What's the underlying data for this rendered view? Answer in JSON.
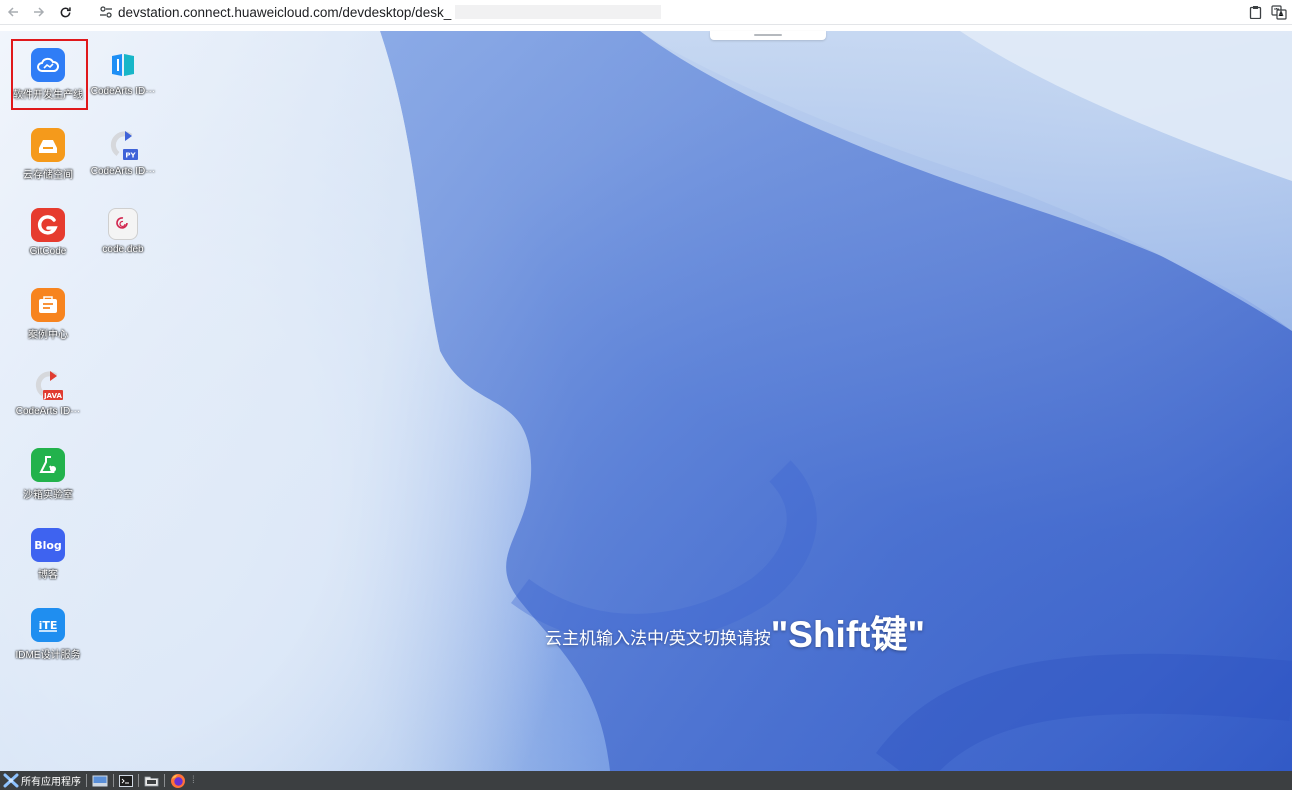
{
  "browser": {
    "back_icon": "arrow-left-icon",
    "forward_icon": "arrow-right-icon",
    "reload_icon": "reload-icon",
    "site_info_icon": "site-settings-icon",
    "url": "devstation.connect.huaweicloud.com/devdesktop/desk_",
    "tools": [
      "clipboard-icon",
      "translate-icon"
    ]
  },
  "desktop": {
    "icons_col1": [
      {
        "label": "软件开发生产线",
        "icon": "cloud-pipeline-icon",
        "color": "#2f7df6",
        "selected": true
      },
      {
        "label": "云存储空间",
        "icon": "cloud-storage-icon",
        "color": "#f59a1b"
      },
      {
        "label": "GitCode",
        "icon": "gitcode-icon",
        "color": "#e63b2e"
      },
      {
        "label": "案例中心",
        "icon": "case-center-icon",
        "color": "#f7841f"
      },
      {
        "label": "CodeArts ID···",
        "icon": "codearts-java-icon",
        "color": "#e03c31"
      },
      {
        "label": "沙箱实验室",
        "icon": "sandbox-lab-icon",
        "color": "#22b24c"
      },
      {
        "label": "博客",
        "icon": "blog-icon",
        "color": "#3e63f0"
      },
      {
        "label": "IDME设计服务",
        "icon": "idme-icon",
        "color": "#1f8ef0"
      }
    ],
    "icons_col2": [
      {
        "label": "CodeArts ID···",
        "icon": "codearts-ide-icon",
        "color": "#1e8ff5"
      },
      {
        "label": "CodeArts ID···",
        "icon": "codearts-python-icon",
        "color": "#3f63d8"
      },
      {
        "label": "code.deb",
        "icon": "debian-package-icon",
        "color": "#f4f4f4"
      }
    ],
    "ime_hint_prefix": "云主机输入法中/英文切换请按",
    "ime_hint_key": "\"Shift键\""
  },
  "taskbar": {
    "apps_label": "所有应用程序",
    "apps_icon": "xfce-mouse-icon",
    "items": [
      "desktop-icon",
      "terminal-icon",
      "file-manager-icon",
      "firefox-icon"
    ]
  }
}
